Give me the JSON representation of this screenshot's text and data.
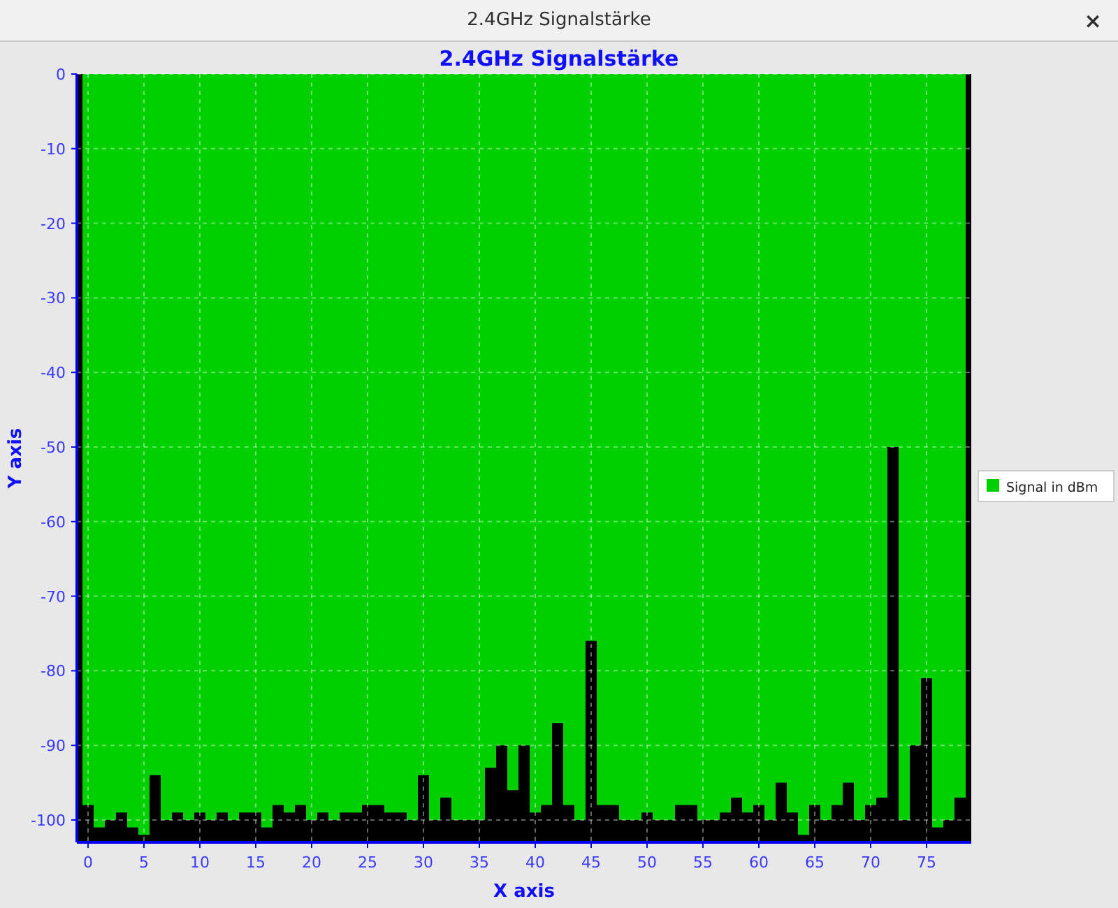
{
  "window": {
    "title": "2.4GHz Signalstärke",
    "close": "×"
  },
  "chart_data": {
    "type": "bar",
    "title": "2.4GHz Signalstärke",
    "xlabel": "X axis",
    "ylabel": "Y axis",
    "x": [
      0,
      1,
      2,
      3,
      4,
      5,
      6,
      7,
      8,
      9,
      10,
      11,
      12,
      13,
      14,
      15,
      16,
      17,
      18,
      19,
      20,
      21,
      22,
      23,
      24,
      25,
      26,
      27,
      28,
      29,
      30,
      31,
      32,
      33,
      34,
      35,
      36,
      37,
      38,
      39,
      40,
      41,
      42,
      43,
      44,
      45,
      46,
      47,
      48,
      49,
      50,
      51,
      52,
      53,
      54,
      55,
      56,
      57,
      58,
      59,
      60,
      61,
      62,
      63,
      64,
      65,
      66,
      67,
      68,
      69,
      70,
      71,
      72,
      73,
      74,
      75,
      76,
      77,
      78
    ],
    "series": [
      {
        "name": "Signal in dBm",
        "color": "#00d000",
        "values": [
          -98,
          -101,
          -100,
          -99,
          -101,
          -102,
          -94,
          -100,
          -99,
          -100,
          -99,
          -100,
          -99,
          -100,
          -99,
          -99,
          -101,
          -98,
          -99,
          -98,
          -100,
          -99,
          -100,
          -99,
          -99,
          -98,
          -98,
          -99,
          -99,
          -100,
          -94,
          -100,
          -97,
          -100,
          -100,
          -100,
          -93,
          -90,
          -96,
          -90,
          -99,
          -98,
          -87,
          -98,
          -100,
          -76,
          -98,
          -98,
          -100,
          -100,
          -99,
          -100,
          -100,
          -98,
          -98,
          -100,
          -100,
          -99,
          -97,
          -99,
          -98,
          -100,
          -95,
          -99,
          -102,
          -98,
          -100,
          -98,
          -95,
          -100,
          -98,
          -97,
          -50,
          -100,
          -90,
          -81,
          -101,
          -100,
          -97
        ]
      }
    ],
    "grid": true,
    "xlim": [
      -1,
      79
    ],
    "ylim": [
      -103,
      0
    ],
    "xticks": [
      0,
      5,
      10,
      15,
      20,
      25,
      30,
      35,
      40,
      45,
      50,
      55,
      60,
      65,
      70,
      75
    ],
    "yticks": [
      0,
      -10,
      -20,
      -30,
      -40,
      -50,
      -60,
      -70,
      -80,
      -90,
      -100
    ]
  }
}
